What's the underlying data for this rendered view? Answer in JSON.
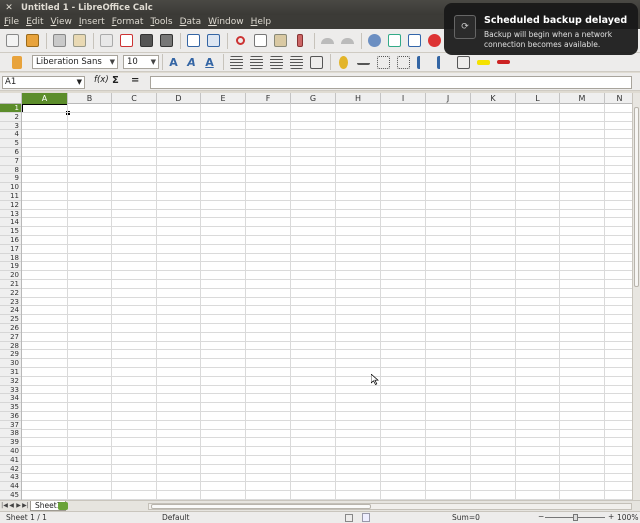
{
  "window": {
    "title": "Untitled 1 - LibreOffice Calc"
  },
  "menu": [
    {
      "label": "File",
      "key": "F",
      "rest": "ile"
    },
    {
      "label": "Edit",
      "key": "E",
      "rest": "dit"
    },
    {
      "label": "View",
      "key": "V",
      "rest": "iew"
    },
    {
      "label": "Insert",
      "key": "I",
      "rest": "nsert"
    },
    {
      "label": "Format",
      "key": "F",
      "rest": "ormat"
    },
    {
      "label": "Tools",
      "key": "T",
      "rest": "ools"
    },
    {
      "label": "Data",
      "key": "D",
      "rest": "ata"
    },
    {
      "label": "Window",
      "key": "W",
      "rest": "indow"
    },
    {
      "label": "Help",
      "key": "H",
      "rest": "elp"
    }
  ],
  "formatting": {
    "font_name": "Liberation Sans",
    "font_size": "10"
  },
  "formula_bar": {
    "cell_reference": "A1",
    "function_wizard": "f(x)",
    "sum_symbol": "Σ",
    "equals_symbol": "=",
    "content": ""
  },
  "grid": {
    "columns": [
      "A",
      "B",
      "C",
      "D",
      "E",
      "F",
      "G",
      "H",
      "I",
      "J",
      "K",
      "L",
      "M",
      "N"
    ],
    "rows": [
      "1",
      "2",
      "3",
      "4",
      "5",
      "6",
      "7",
      "8",
      "9",
      "10",
      "11",
      "12",
      "13",
      "14",
      "15",
      "16",
      "17",
      "18",
      "19",
      "20",
      "21",
      "22",
      "23",
      "24",
      "25",
      "26",
      "27",
      "28",
      "29",
      "30",
      "31",
      "32",
      "33",
      "34",
      "35",
      "36",
      "37",
      "38",
      "39",
      "40",
      "41",
      "42",
      "43",
      "44",
      "45"
    ],
    "selected_column": "A",
    "selected_row": "1"
  },
  "sheets": {
    "active_tab": "Sheet1"
  },
  "status": {
    "sheet_info": "Sheet 1 / 1",
    "page_style": "Default",
    "sum": "Sum=0",
    "zoom": "100%"
  },
  "notification": {
    "title": "Scheduled backup delayed",
    "body": "Backup will begin when a network connection becomes available.",
    "icon": "backup-icon"
  },
  "colors": {
    "selection": "#5c8d2b",
    "menubar": "#3c3b37",
    "accent": "#3465a4"
  }
}
